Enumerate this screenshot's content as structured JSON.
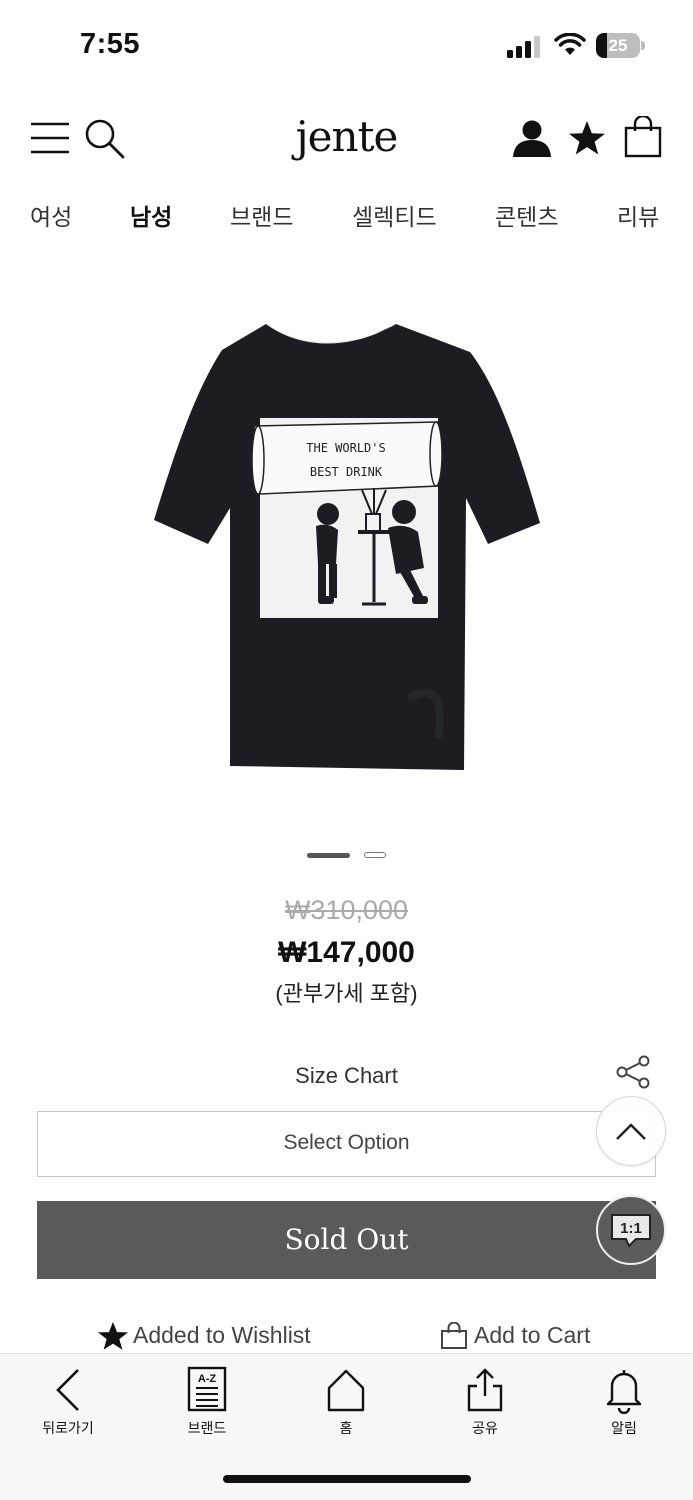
{
  "status_bar": {
    "time": "7:55",
    "battery": "25",
    "battery_level": 0.25
  },
  "header": {
    "logo": "jente",
    "icons": [
      "menu-icon",
      "search-icon",
      "user-icon",
      "star-icon",
      "bag-icon"
    ]
  },
  "categories": [
    {
      "label": "여성",
      "active": false
    },
    {
      "label": "남성",
      "active": true
    },
    {
      "label": "브랜드",
      "active": false
    },
    {
      "label": "셀렉티드",
      "active": false
    },
    {
      "label": "콘텐츠",
      "active": false
    },
    {
      "label": "리뷰",
      "active": false
    }
  ],
  "product": {
    "print_text_line1": "THE WORLD'S",
    "print_text_line2": "BEST DRINK",
    "shirt_color": "#1c1c22",
    "image_count": 2,
    "current_image": 1
  },
  "pricing": {
    "original": "₩310,000",
    "sale": "₩147,000",
    "note": "(관부가세 포함)"
  },
  "options": {
    "size_chart": "Size Chart",
    "select_placeholder": "Select Option"
  },
  "actions": {
    "sold_out": "Sold Out",
    "wishlist": "Added to Wishlist",
    "cart": "Add to Cart",
    "chat_icon_text": "1:1"
  },
  "tab_bar": [
    {
      "label": "뒤로가기",
      "icon": "back-icon"
    },
    {
      "label": "브랜드",
      "icon": "brand-az-icon"
    },
    {
      "label": "홈",
      "icon": "home-icon"
    },
    {
      "label": "공유",
      "icon": "share-icon"
    },
    {
      "label": "알림",
      "icon": "bell-icon"
    }
  ],
  "colors": {
    "sold_out_bg": "#5a5a5a",
    "tab_bar_bg": "#f7f7f7",
    "price_strike": "#aaaaaa"
  }
}
